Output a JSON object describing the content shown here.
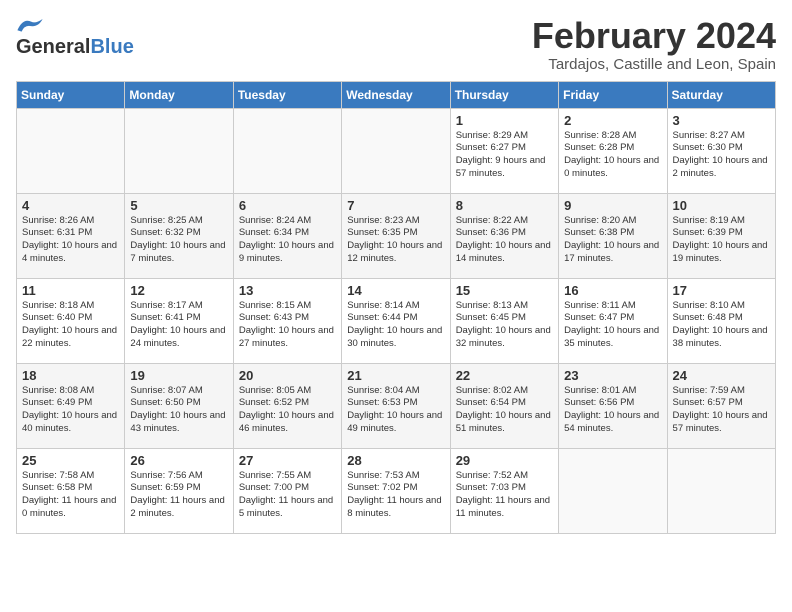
{
  "header": {
    "logo_line1": "General",
    "logo_line2": "Blue",
    "month_title": "February 2024",
    "subtitle": "Tardajos, Castille and Leon, Spain"
  },
  "weekdays": [
    "Sunday",
    "Monday",
    "Tuesday",
    "Wednesday",
    "Thursday",
    "Friday",
    "Saturday"
  ],
  "weeks": [
    [
      {
        "day": "",
        "info": ""
      },
      {
        "day": "",
        "info": ""
      },
      {
        "day": "",
        "info": ""
      },
      {
        "day": "",
        "info": ""
      },
      {
        "day": "1",
        "info": "Sunrise: 8:29 AM\nSunset: 6:27 PM\nDaylight: 9 hours and 57 minutes."
      },
      {
        "day": "2",
        "info": "Sunrise: 8:28 AM\nSunset: 6:28 PM\nDaylight: 10 hours and 0 minutes."
      },
      {
        "day": "3",
        "info": "Sunrise: 8:27 AM\nSunset: 6:30 PM\nDaylight: 10 hours and 2 minutes."
      }
    ],
    [
      {
        "day": "4",
        "info": "Sunrise: 8:26 AM\nSunset: 6:31 PM\nDaylight: 10 hours and 4 minutes."
      },
      {
        "day": "5",
        "info": "Sunrise: 8:25 AM\nSunset: 6:32 PM\nDaylight: 10 hours and 7 minutes."
      },
      {
        "day": "6",
        "info": "Sunrise: 8:24 AM\nSunset: 6:34 PM\nDaylight: 10 hours and 9 minutes."
      },
      {
        "day": "7",
        "info": "Sunrise: 8:23 AM\nSunset: 6:35 PM\nDaylight: 10 hours and 12 minutes."
      },
      {
        "day": "8",
        "info": "Sunrise: 8:22 AM\nSunset: 6:36 PM\nDaylight: 10 hours and 14 minutes."
      },
      {
        "day": "9",
        "info": "Sunrise: 8:20 AM\nSunset: 6:38 PM\nDaylight: 10 hours and 17 minutes."
      },
      {
        "day": "10",
        "info": "Sunrise: 8:19 AM\nSunset: 6:39 PM\nDaylight: 10 hours and 19 minutes."
      }
    ],
    [
      {
        "day": "11",
        "info": "Sunrise: 8:18 AM\nSunset: 6:40 PM\nDaylight: 10 hours and 22 minutes."
      },
      {
        "day": "12",
        "info": "Sunrise: 8:17 AM\nSunset: 6:41 PM\nDaylight: 10 hours and 24 minutes."
      },
      {
        "day": "13",
        "info": "Sunrise: 8:15 AM\nSunset: 6:43 PM\nDaylight: 10 hours and 27 minutes."
      },
      {
        "day": "14",
        "info": "Sunrise: 8:14 AM\nSunset: 6:44 PM\nDaylight: 10 hours and 30 minutes."
      },
      {
        "day": "15",
        "info": "Sunrise: 8:13 AM\nSunset: 6:45 PM\nDaylight: 10 hours and 32 minutes."
      },
      {
        "day": "16",
        "info": "Sunrise: 8:11 AM\nSunset: 6:47 PM\nDaylight: 10 hours and 35 minutes."
      },
      {
        "day": "17",
        "info": "Sunrise: 8:10 AM\nSunset: 6:48 PM\nDaylight: 10 hours and 38 minutes."
      }
    ],
    [
      {
        "day": "18",
        "info": "Sunrise: 8:08 AM\nSunset: 6:49 PM\nDaylight: 10 hours and 40 minutes."
      },
      {
        "day": "19",
        "info": "Sunrise: 8:07 AM\nSunset: 6:50 PM\nDaylight: 10 hours and 43 minutes."
      },
      {
        "day": "20",
        "info": "Sunrise: 8:05 AM\nSunset: 6:52 PM\nDaylight: 10 hours and 46 minutes."
      },
      {
        "day": "21",
        "info": "Sunrise: 8:04 AM\nSunset: 6:53 PM\nDaylight: 10 hours and 49 minutes."
      },
      {
        "day": "22",
        "info": "Sunrise: 8:02 AM\nSunset: 6:54 PM\nDaylight: 10 hours and 51 minutes."
      },
      {
        "day": "23",
        "info": "Sunrise: 8:01 AM\nSunset: 6:56 PM\nDaylight: 10 hours and 54 minutes."
      },
      {
        "day": "24",
        "info": "Sunrise: 7:59 AM\nSunset: 6:57 PM\nDaylight: 10 hours and 57 minutes."
      }
    ],
    [
      {
        "day": "25",
        "info": "Sunrise: 7:58 AM\nSunset: 6:58 PM\nDaylight: 11 hours and 0 minutes."
      },
      {
        "day": "26",
        "info": "Sunrise: 7:56 AM\nSunset: 6:59 PM\nDaylight: 11 hours and 2 minutes."
      },
      {
        "day": "27",
        "info": "Sunrise: 7:55 AM\nSunset: 7:00 PM\nDaylight: 11 hours and 5 minutes."
      },
      {
        "day": "28",
        "info": "Sunrise: 7:53 AM\nSunset: 7:02 PM\nDaylight: 11 hours and 8 minutes."
      },
      {
        "day": "29",
        "info": "Sunrise: 7:52 AM\nSunset: 7:03 PM\nDaylight: 11 hours and 11 minutes."
      },
      {
        "day": "",
        "info": ""
      },
      {
        "day": "",
        "info": ""
      }
    ]
  ]
}
